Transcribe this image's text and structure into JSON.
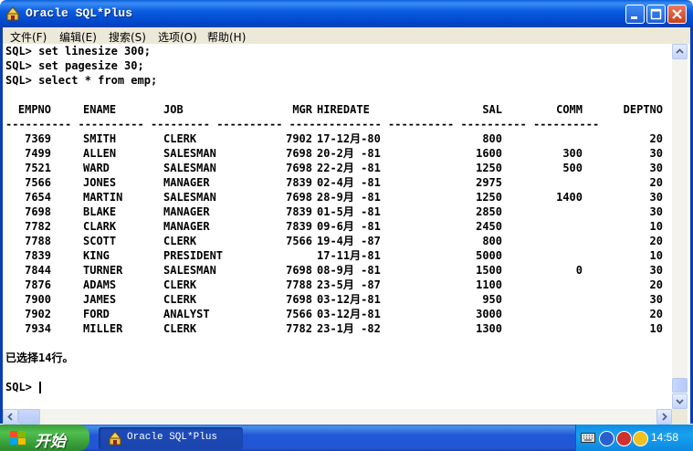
{
  "window": {
    "title": "Oracle SQL*Plus"
  },
  "menu": [
    "文件(F)",
    "编辑(E)",
    "搜索(S)",
    "选项(O)",
    "帮助(H)"
  ],
  "commands": [
    "SQL> set linesize 300;",
    "SQL> set pagesize 30;",
    "SQL> select * from emp;"
  ],
  "table": {
    "headers": [
      "EMPNO",
      "ENAME",
      "JOB",
      "MGR",
      "HIREDATE",
      "SAL",
      "COMM",
      "DEPTNO"
    ],
    "separator": "---------- ---------- --------- ---------- -------------- ---------- ---------- ----------",
    "rows": [
      [
        "7369",
        "SMITH",
        "CLERK",
        "7902",
        "17-12月-80",
        "800",
        "",
        "20"
      ],
      [
        "7499",
        "ALLEN",
        "SALESMAN",
        "7698",
        "20-2月 -81",
        "1600",
        "300",
        "30"
      ],
      [
        "7521",
        "WARD",
        "SALESMAN",
        "7698",
        "22-2月 -81",
        "1250",
        "500",
        "30"
      ],
      [
        "7566",
        "JONES",
        "MANAGER",
        "7839",
        "02-4月 -81",
        "2975",
        "",
        "20"
      ],
      [
        "7654",
        "MARTIN",
        "SALESMAN",
        "7698",
        "28-9月 -81",
        "1250",
        "1400",
        "30"
      ],
      [
        "7698",
        "BLAKE",
        "MANAGER",
        "7839",
        "01-5月 -81",
        "2850",
        "",
        "30"
      ],
      [
        "7782",
        "CLARK",
        "MANAGER",
        "7839",
        "09-6月 -81",
        "2450",
        "",
        "10"
      ],
      [
        "7788",
        "SCOTT",
        "CLERK",
        "7566",
        "19-4月 -87",
        "800",
        "",
        "20"
      ],
      [
        "7839",
        "KING",
        "PRESIDENT",
        "",
        "17-11月-81",
        "5000",
        "",
        "10"
      ],
      [
        "7844",
        "TURNER",
        "SALESMAN",
        "7698",
        "08-9月 -81",
        "1500",
        "0",
        "30"
      ],
      [
        "7876",
        "ADAMS",
        "CLERK",
        "7788",
        "23-5月 -87",
        "1100",
        "",
        "20"
      ],
      [
        "7900",
        "JAMES",
        "CLERK",
        "7698",
        "03-12月-81",
        "950",
        "",
        "30"
      ],
      [
        "7902",
        "FORD",
        "ANALYST",
        "7566",
        "03-12月-81",
        "3000",
        "",
        "20"
      ],
      [
        "7934",
        "MILLER",
        "CLERK",
        "7782",
        "23-1月 -82",
        "1300",
        "",
        "10"
      ]
    ]
  },
  "result_message": "已选择14行。",
  "prompt": "SQL>",
  "taskbar": {
    "start_label": "开始",
    "task_label": "Oracle SQL*Plus",
    "clock": "14:58"
  },
  "icons": [
    "app-icon",
    "minimize-icon",
    "maximize-icon",
    "close-icon",
    "windows-logo-icon",
    "keyboard-icon",
    "network-icon",
    "security-shield-icon"
  ],
  "colors": {
    "titlebar": "#0b5ce0",
    "taskbar": "#2157d7",
    "start": "#3c9b3c",
    "tray": "#19a0ee"
  }
}
